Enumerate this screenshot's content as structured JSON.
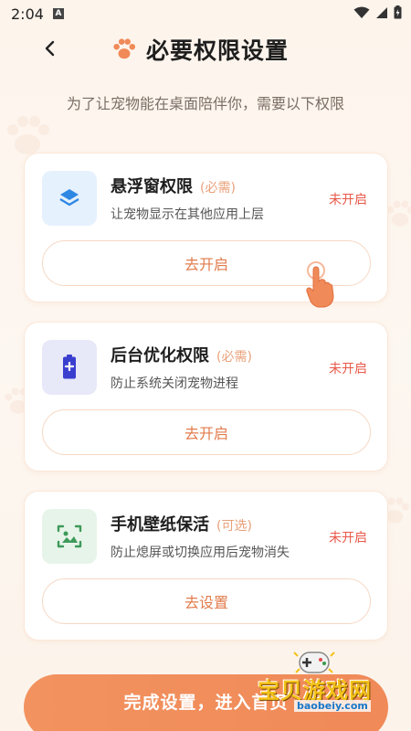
{
  "status_bar": {
    "time": "2:04",
    "a_label": "A"
  },
  "header": {
    "title": "必要权限设置"
  },
  "subtitle": "为了让宠物能在桌面陪伴你，需要以下权限",
  "cards": [
    {
      "title": "悬浮窗权限",
      "tag": "(必需)",
      "desc": "让宠物显示在其他应用上层",
      "status": "未开启",
      "button": "去开启",
      "icon": "layers-icon",
      "icon_bg": "#e5f1fd",
      "icon_color": "#2f87e4"
    },
    {
      "title": "后台优化权限",
      "tag": "(必需)",
      "desc": "防止系统关闭宠物进程",
      "status": "未开启",
      "button": "去开启",
      "icon": "battery-icon",
      "icon_bg": "#e7e8f8",
      "icon_color": "#3a3ecf"
    },
    {
      "title": "手机壁纸保活",
      "tag": "(可选)",
      "desc": "防止熄屏或切换应用后宠物消失",
      "status": "未开启",
      "button": "去设置",
      "icon": "wallpaper-icon",
      "icon_bg": "#e7f4e9",
      "icon_color": "#3d9a5a"
    }
  ],
  "bottom_button": "完成设置，进入首页",
  "watermark": {
    "text": "宝贝游戏网",
    "url": "baobeiy.com"
  },
  "colors": {
    "accent": "#f08a58",
    "status_off": "#e8594a",
    "tag": "#e9a07a"
  }
}
